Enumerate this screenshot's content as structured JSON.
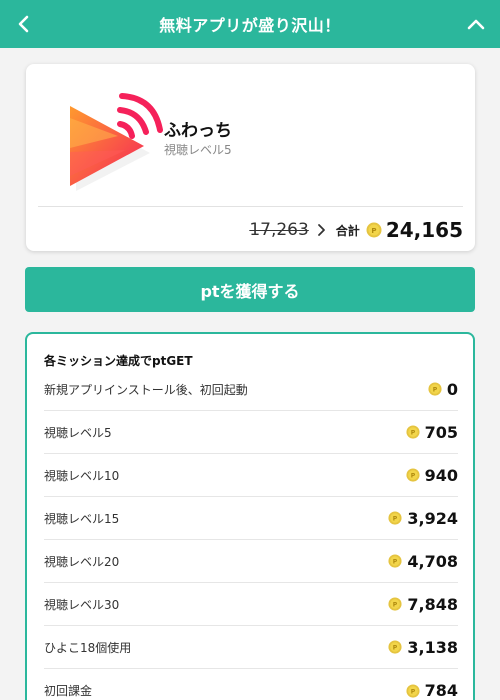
{
  "header": {
    "title": "無料アプリが盛り沢山！"
  },
  "app": {
    "name": "ふわっち",
    "subtitle": "視聴レベル5",
    "old_points": "17,263",
    "total_label": "合計",
    "total_points": "24,165"
  },
  "cta": {
    "label": "ptを獲得する"
  },
  "missions": {
    "heading": "各ミッション達成でptGET",
    "rows": [
      {
        "label": "新規アプリインストール後、初回起動",
        "points": "0"
      },
      {
        "label": "視聴レベル5",
        "points": "705"
      },
      {
        "label": "視聴レベル10",
        "points": "940"
      },
      {
        "label": "視聴レベル15",
        "points": "3,924"
      },
      {
        "label": "視聴レベル20",
        "points": "4,708"
      },
      {
        "label": "視聴レベル30",
        "points": "7,848"
      },
      {
        "label": "ひよこ18個使用",
        "points": "3,138"
      },
      {
        "label": "初回課金",
        "points": "784"
      }
    ]
  },
  "colors": {
    "accent": "#2bb79c",
    "coin": "#f2d54a"
  },
  "icons": {
    "back": "chevron-left-icon",
    "collapse": "chevron-up-icon",
    "arrow": "chevron-right-icon",
    "coin": "point-coin-icon",
    "app": "fuwacchi-app-icon"
  }
}
